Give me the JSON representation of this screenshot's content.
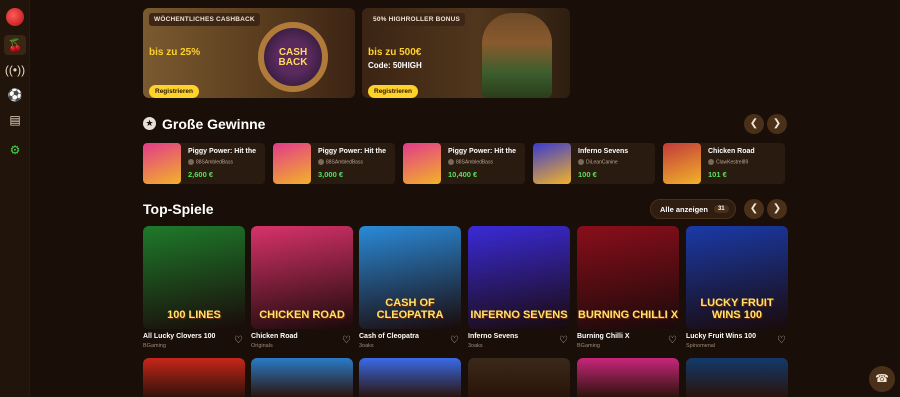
{
  "sidebar": {
    "logo": "cherry-logo",
    "items": [
      {
        "icon": "cherries-icon",
        "active": true
      },
      {
        "icon": "live-icon"
      },
      {
        "icon": "football-icon"
      },
      {
        "icon": "gamepad-icon"
      },
      {
        "icon": "dragon-icon"
      }
    ]
  },
  "promos": [
    {
      "tag": "WÖCHENTLICHES CASHBACK",
      "amount": "bis zu 25%",
      "code": "",
      "button": "Registrieren",
      "art_text": "CASH BACK"
    },
    {
      "tag": "50% HIGHROLLER BONUS",
      "amount": "bis zu 500€",
      "code": "Code: 50HIGH",
      "button": "Registrieren"
    }
  ],
  "big_wins": {
    "title": "Große Gewinne",
    "items": [
      {
        "game": "Piggy Power: Hit the",
        "user": "88SAmbledBass",
        "amount": "2,600 €",
        "color": "#e23a8a"
      },
      {
        "game": "Piggy Power: Hit the",
        "user": "88SAmbledBass",
        "amount": "3,000 €",
        "color": "#e23a8a"
      },
      {
        "game": "Piggy Power: Hit the",
        "user": "88SAmbledBass",
        "amount": "10,400 €",
        "color": "#e23a8a"
      },
      {
        "game": "Inferno Sevens",
        "user": "DiLeanCanine",
        "amount": "100 €",
        "color": "#3a3ad0"
      },
      {
        "game": "Chicken Road",
        "user": "ClawKestrel89",
        "amount": "101 €",
        "color": "#c23a3a"
      }
    ]
  },
  "top_games": {
    "title": "Top-Spiele",
    "see_all": "Alle anzeigen",
    "count": "31",
    "games": [
      {
        "name": "All Lucky Clovers 100",
        "provider": "BGaming",
        "art": "100 LINES",
        "bg": "#1e7a2a"
      },
      {
        "name": "Chicken Road",
        "provider": "Originals",
        "art": "CHICKEN ROAD",
        "bg": "#d8326a"
      },
      {
        "name": "Cash of Cleopatra",
        "provider": "3oaks",
        "art": "CASH OF CLEOPATRA",
        "bg": "#2a8ad8"
      },
      {
        "name": "Inferno Sevens",
        "provider": "3oaks",
        "art": "INFERNO SEVENS",
        "bg": "#3a2ad8"
      },
      {
        "name": "Burning Chilli X",
        "provider": "BGaming",
        "art": "BURNING CHILLI X",
        "bg": "#8a0e1a"
      },
      {
        "name": "Lucky Fruit Wins 100",
        "provider": "Spinomenal",
        "art": "LUCKY FRUIT WINS 100",
        "bg": "#1a3aa8"
      }
    ],
    "row2_colors": [
      "#c8261a",
      "#2a7ac8",
      "#3a6ae8",
      "#3a2a1a",
      "#c8267a",
      "#123a6a"
    ]
  }
}
